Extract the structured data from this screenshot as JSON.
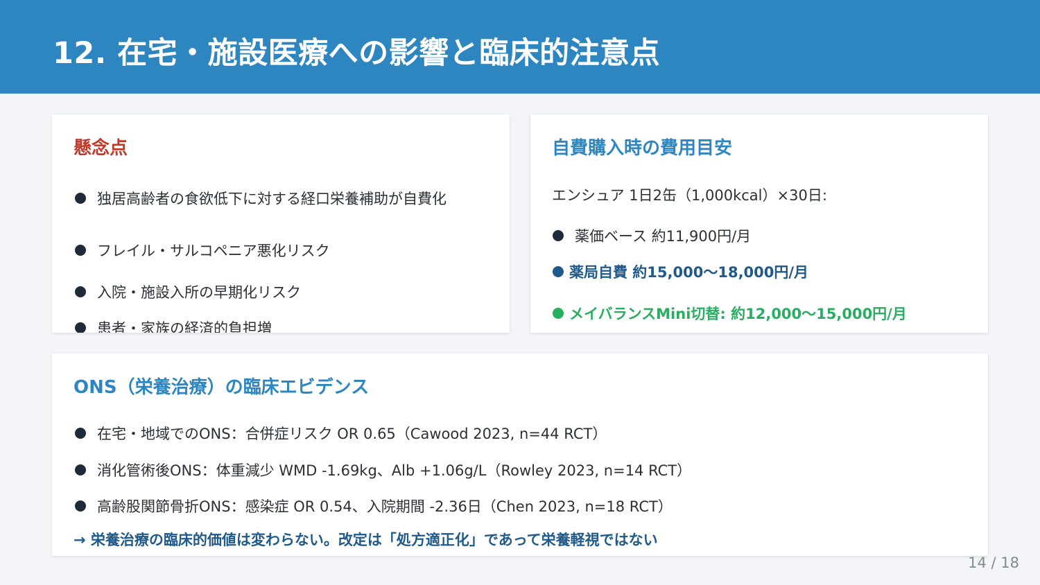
{
  "header": {
    "title": "12. 在宅・施設医療への影響と臨床的注意点",
    "background_color": "#2e86c1"
  },
  "concerns": {
    "title": "懸念点",
    "title_color": "#c0392b",
    "items": [
      "独居高齢者の食欲低下に対する経口栄養補助が自費化",
      "フレイル・サルコペニア悪化リスク",
      "入院・施設入所の早期化リスク",
      "患者・家族の経済的負担増"
    ]
  },
  "cost": {
    "title": "自費購入時の費用目安",
    "intro": "エンシュア 1日2缶（1,000kcal）×30日:",
    "items": [
      "薬価ベース 約11,900円/月",
      "薬局自費 約15,000〜18,000円/月",
      "メイバランスMini切替: 約12,000〜15,000円/月"
    ],
    "accent_blue": "#1f5a8a",
    "accent_green": "#27ae60"
  },
  "evidence": {
    "title": "ONS（栄養治療）の臨床エビデンス",
    "items": [
      "在宅・地域でのONS：合併症リスク OR 0.65（Cawood 2023, n=44 RCT）",
      "消化管術後ONS：体重減少 WMD -1.69kg、Alb +1.06g/L（Rowley 2023, n=14 RCT）",
      "高齢股関節骨折ONS：感染症 OR 0.54、入院期間 -2.36日（Chen 2023, n=18 RCT）"
    ],
    "conclusion": "→ 栄養治療の臨床的価値は変わらない。改定は「処方適正化」であって栄養軽視ではない"
  },
  "page": {
    "number": "14 / 18"
  }
}
